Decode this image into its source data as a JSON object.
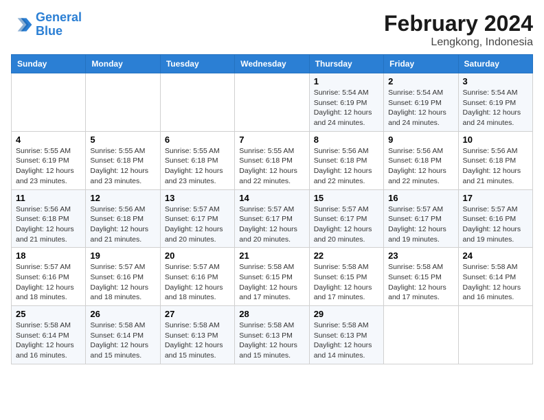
{
  "header": {
    "logo_line1": "General",
    "logo_line2": "Blue",
    "main_title": "February 2024",
    "subtitle": "Lengkong, Indonesia"
  },
  "weekdays": [
    "Sunday",
    "Monday",
    "Tuesday",
    "Wednesday",
    "Thursday",
    "Friday",
    "Saturday"
  ],
  "weeks": [
    [
      {
        "day": "",
        "info": ""
      },
      {
        "day": "",
        "info": ""
      },
      {
        "day": "",
        "info": ""
      },
      {
        "day": "",
        "info": ""
      },
      {
        "day": "1",
        "info": "Sunrise: 5:54 AM\nSunset: 6:19 PM\nDaylight: 12 hours\nand 24 minutes."
      },
      {
        "day": "2",
        "info": "Sunrise: 5:54 AM\nSunset: 6:19 PM\nDaylight: 12 hours\nand 24 minutes."
      },
      {
        "day": "3",
        "info": "Sunrise: 5:54 AM\nSunset: 6:19 PM\nDaylight: 12 hours\nand 24 minutes."
      }
    ],
    [
      {
        "day": "4",
        "info": "Sunrise: 5:55 AM\nSunset: 6:19 PM\nDaylight: 12 hours\nand 23 minutes."
      },
      {
        "day": "5",
        "info": "Sunrise: 5:55 AM\nSunset: 6:18 PM\nDaylight: 12 hours\nand 23 minutes."
      },
      {
        "day": "6",
        "info": "Sunrise: 5:55 AM\nSunset: 6:18 PM\nDaylight: 12 hours\nand 23 minutes."
      },
      {
        "day": "7",
        "info": "Sunrise: 5:55 AM\nSunset: 6:18 PM\nDaylight: 12 hours\nand 22 minutes."
      },
      {
        "day": "8",
        "info": "Sunrise: 5:56 AM\nSunset: 6:18 PM\nDaylight: 12 hours\nand 22 minutes."
      },
      {
        "day": "9",
        "info": "Sunrise: 5:56 AM\nSunset: 6:18 PM\nDaylight: 12 hours\nand 22 minutes."
      },
      {
        "day": "10",
        "info": "Sunrise: 5:56 AM\nSunset: 6:18 PM\nDaylight: 12 hours\nand 21 minutes."
      }
    ],
    [
      {
        "day": "11",
        "info": "Sunrise: 5:56 AM\nSunset: 6:18 PM\nDaylight: 12 hours\nand 21 minutes."
      },
      {
        "day": "12",
        "info": "Sunrise: 5:56 AM\nSunset: 6:18 PM\nDaylight: 12 hours\nand 21 minutes."
      },
      {
        "day": "13",
        "info": "Sunrise: 5:57 AM\nSunset: 6:17 PM\nDaylight: 12 hours\nand 20 minutes."
      },
      {
        "day": "14",
        "info": "Sunrise: 5:57 AM\nSunset: 6:17 PM\nDaylight: 12 hours\nand 20 minutes."
      },
      {
        "day": "15",
        "info": "Sunrise: 5:57 AM\nSunset: 6:17 PM\nDaylight: 12 hours\nand 20 minutes."
      },
      {
        "day": "16",
        "info": "Sunrise: 5:57 AM\nSunset: 6:17 PM\nDaylight: 12 hours\nand 19 minutes."
      },
      {
        "day": "17",
        "info": "Sunrise: 5:57 AM\nSunset: 6:16 PM\nDaylight: 12 hours\nand 19 minutes."
      }
    ],
    [
      {
        "day": "18",
        "info": "Sunrise: 5:57 AM\nSunset: 6:16 PM\nDaylight: 12 hours\nand 18 minutes."
      },
      {
        "day": "19",
        "info": "Sunrise: 5:57 AM\nSunset: 6:16 PM\nDaylight: 12 hours\nand 18 minutes."
      },
      {
        "day": "20",
        "info": "Sunrise: 5:57 AM\nSunset: 6:16 PM\nDaylight: 12 hours\nand 18 minutes."
      },
      {
        "day": "21",
        "info": "Sunrise: 5:58 AM\nSunset: 6:15 PM\nDaylight: 12 hours\nand 17 minutes."
      },
      {
        "day": "22",
        "info": "Sunrise: 5:58 AM\nSunset: 6:15 PM\nDaylight: 12 hours\nand 17 minutes."
      },
      {
        "day": "23",
        "info": "Sunrise: 5:58 AM\nSunset: 6:15 PM\nDaylight: 12 hours\nand 17 minutes."
      },
      {
        "day": "24",
        "info": "Sunrise: 5:58 AM\nSunset: 6:14 PM\nDaylight: 12 hours\nand 16 minutes."
      }
    ],
    [
      {
        "day": "25",
        "info": "Sunrise: 5:58 AM\nSunset: 6:14 PM\nDaylight: 12 hours\nand 16 minutes."
      },
      {
        "day": "26",
        "info": "Sunrise: 5:58 AM\nSunset: 6:14 PM\nDaylight: 12 hours\nand 15 minutes."
      },
      {
        "day": "27",
        "info": "Sunrise: 5:58 AM\nSunset: 6:13 PM\nDaylight: 12 hours\nand 15 minutes."
      },
      {
        "day": "28",
        "info": "Sunrise: 5:58 AM\nSunset: 6:13 PM\nDaylight: 12 hours\nand 15 minutes."
      },
      {
        "day": "29",
        "info": "Sunrise: 5:58 AM\nSunset: 6:13 PM\nDaylight: 12 hours\nand 14 minutes."
      },
      {
        "day": "",
        "info": ""
      },
      {
        "day": "",
        "info": ""
      }
    ]
  ]
}
